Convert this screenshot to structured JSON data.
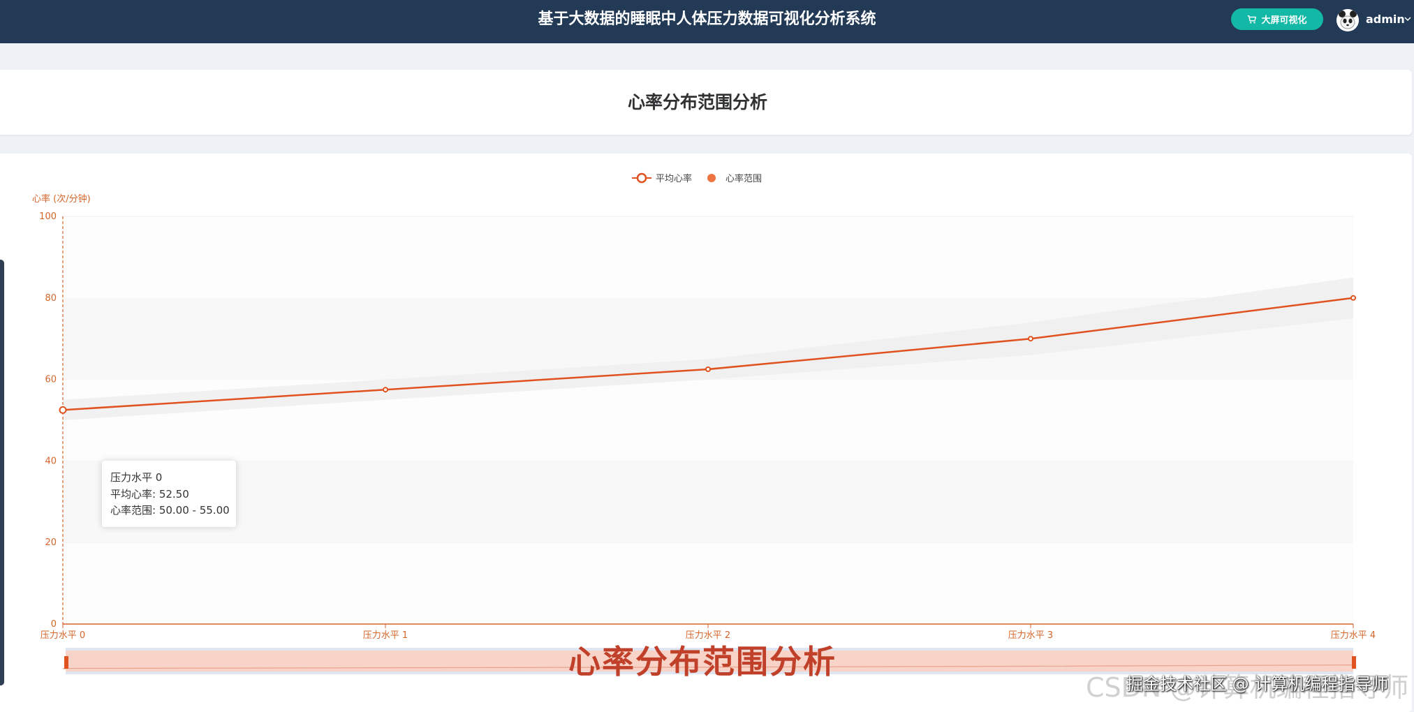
{
  "header": {
    "title": "基于大数据的睡眠中人体压力数据可视化分析系统",
    "bigscreen_label": "大屏可视化",
    "user": "admin"
  },
  "page": {
    "title": "心率分布范围分析"
  },
  "chart_data": {
    "type": "line",
    "title": "",
    "legend": [
      "平均心率",
      "心率范围"
    ],
    "legend_position": "top-center",
    "ylabel": "心率 (次/分钟)",
    "xlabel": "",
    "categories": [
      "压力水平 0",
      "压力水平 1",
      "压力水平 2",
      "压力水平 3",
      "压力水平 4"
    ],
    "ylim": [
      0,
      100
    ],
    "yticks": [
      0,
      20,
      40,
      60,
      80,
      100
    ],
    "series": [
      {
        "name": "平均心率",
        "type": "line",
        "values": [
          52.5,
          57.5,
          62.5,
          70,
          80
        ]
      },
      {
        "name": "心率范围",
        "type": "band",
        "lower": [
          50,
          55,
          60,
          66,
          75
        ],
        "upper": [
          55,
          60,
          65,
          74,
          85
        ]
      }
    ],
    "grid": "alternating horizontal bands",
    "colors": {
      "line": "#e0521f",
      "axis": "#d4652a",
      "band": "#eeeeee"
    },
    "tooltip": {
      "title": "压力水平 0",
      "avg_line": "平均心率: 52.50",
      "range_line": "心率范围: 50.00 - 55.00"
    },
    "datazoom": true
  },
  "overlay": {
    "caption": "心率分布范围分析",
    "watermark_faint": "CSDN @计算机编程指导师",
    "watermark_solid": "掘金技术社区 @ 计算机编程指导师"
  }
}
